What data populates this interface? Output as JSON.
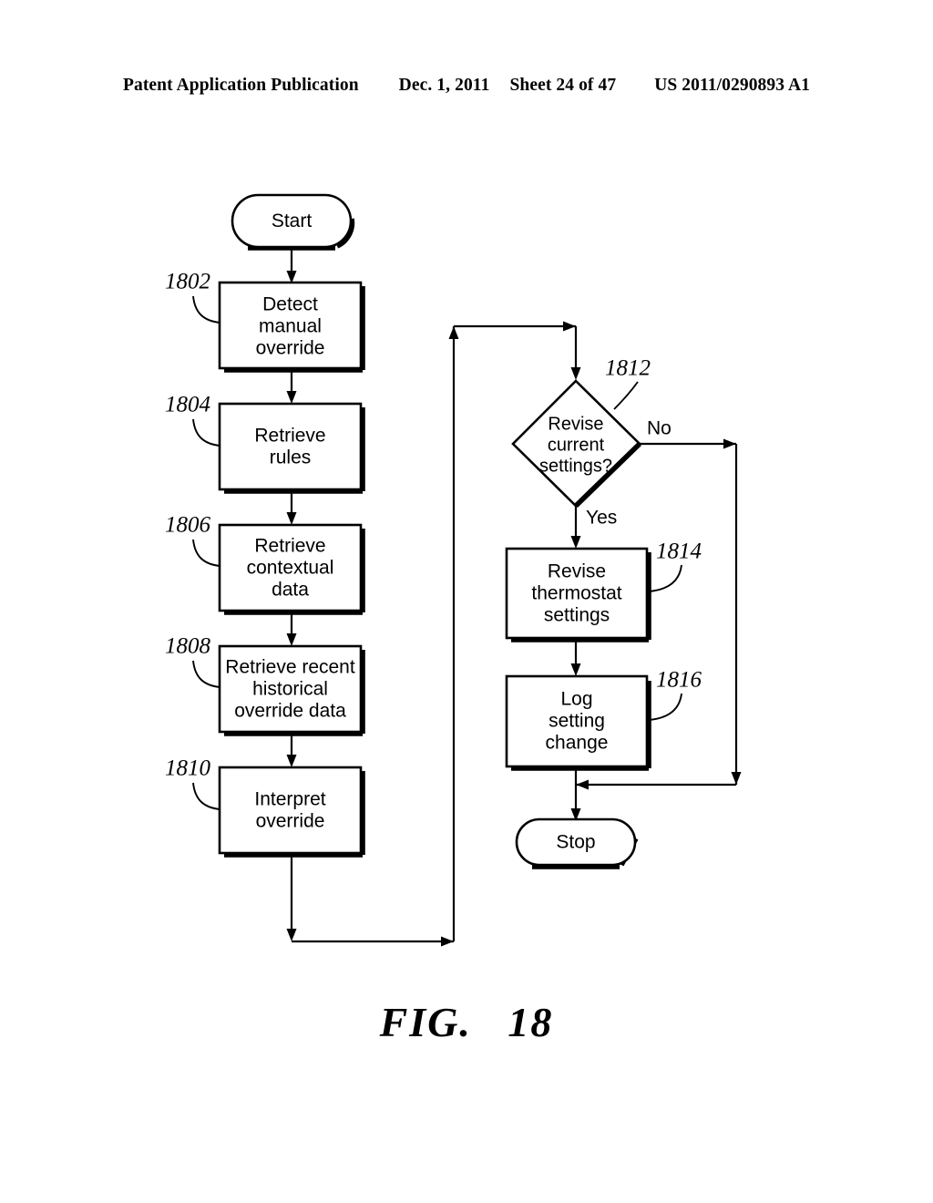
{
  "header": {
    "publication": "Patent Application Publication",
    "date": "Dec. 1, 2011",
    "sheet": "Sheet 24 of 47",
    "patent_number": "US 2011/0290893 A1"
  },
  "figure": {
    "label": "FIG.",
    "number": "18"
  },
  "flowchart": {
    "start_terminal": "Start",
    "stop_terminal": "Stop",
    "steps": [
      {
        "ref": "1802",
        "lines": [
          "Detect",
          "manual",
          "override"
        ]
      },
      {
        "ref": "1804",
        "lines": [
          "Retrieve",
          "rules"
        ]
      },
      {
        "ref": "1806",
        "lines": [
          "Retrieve",
          "contextual",
          "data"
        ]
      },
      {
        "ref": "1808",
        "lines": [
          "Retrieve recent",
          "historical",
          "override data"
        ]
      },
      {
        "ref": "1810",
        "lines": [
          "Interpret",
          "override"
        ]
      },
      {
        "ref": "1814",
        "lines": [
          "Revise",
          "thermostat",
          "settings"
        ]
      },
      {
        "ref": "1816",
        "lines": [
          "Log",
          "setting",
          "change"
        ]
      }
    ],
    "decision": {
      "ref": "1812",
      "lines": [
        "Revise",
        "current",
        "settings?"
      ],
      "yes_label": "Yes",
      "no_label": "No"
    }
  },
  "colors": {
    "ink": "#000000",
    "paper": "#ffffff"
  }
}
